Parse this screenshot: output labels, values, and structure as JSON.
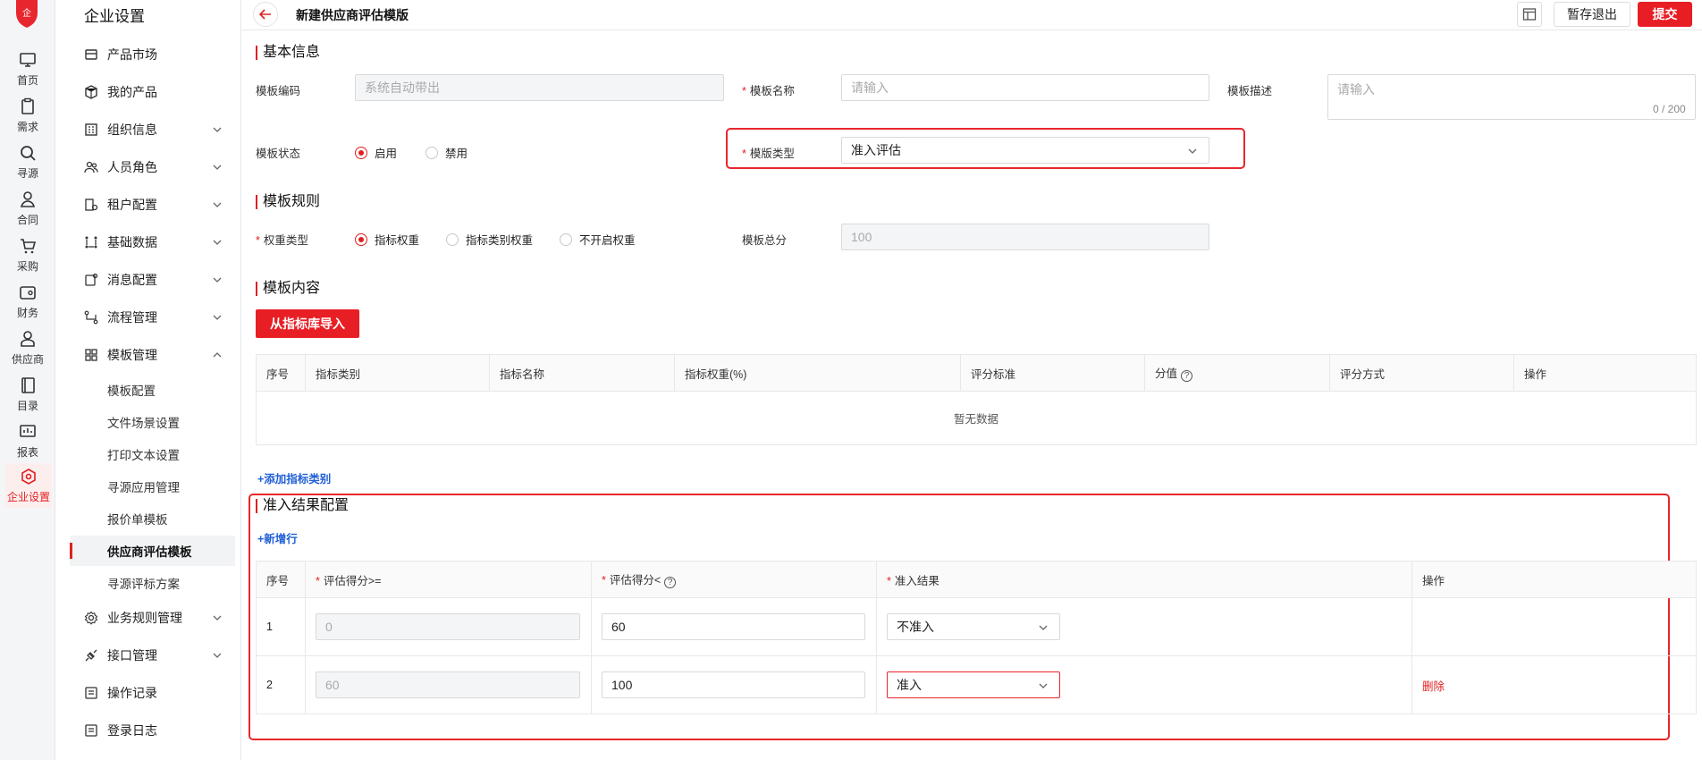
{
  "rail": {
    "logo_text": "企",
    "items": [
      {
        "label": "首页",
        "icon": "monitor-icon"
      },
      {
        "label": "需求",
        "icon": "clipboard-icon"
      },
      {
        "label": "寻源",
        "icon": "search-icon"
      },
      {
        "label": "合同",
        "icon": "person-icon"
      },
      {
        "label": "采购",
        "icon": "cart-icon"
      },
      {
        "label": "财务",
        "icon": "wallet-icon"
      },
      {
        "label": "供应商",
        "icon": "supplier-icon"
      },
      {
        "label": "目录",
        "icon": "book-icon"
      },
      {
        "label": "报表",
        "icon": "report-icon"
      },
      {
        "label": "企业设置",
        "icon": "gear-hex-icon"
      }
    ]
  },
  "menu": {
    "title": "企业设置",
    "items": [
      {
        "label": "产品市场"
      },
      {
        "label": "我的产品"
      },
      {
        "label": "组织信息"
      },
      {
        "label": "人员角色"
      },
      {
        "label": "租户配置"
      },
      {
        "label": "基础数据"
      },
      {
        "label": "消息配置"
      },
      {
        "label": "流程管理"
      },
      {
        "label": "模板管理"
      }
    ],
    "sub_items": [
      {
        "label": "模板配置"
      },
      {
        "label": "文件场景设置"
      },
      {
        "label": "打印文本设置"
      },
      {
        "label": "寻源应用管理"
      },
      {
        "label": "报价单模板"
      },
      {
        "label": "供应商评估模板"
      },
      {
        "label": "寻源评标方案"
      }
    ],
    "bottom_items": [
      {
        "label": "业务规则管理"
      },
      {
        "label": "接口管理"
      },
      {
        "label": "操作记录"
      },
      {
        "label": "登录日志"
      }
    ]
  },
  "header": {
    "title": "新建供应商评估模版",
    "save_exit": "暂存退出",
    "submit": "提交"
  },
  "basic": {
    "title": "基本信息",
    "code_label": "模板编码",
    "code_placeholder": "系统自动带出",
    "name_label": "模板名称",
    "name_placeholder": "请输入",
    "desc_label": "模板描述",
    "desc_placeholder": "请输入",
    "desc_counter": "0 / 200",
    "status_label": "模板状态",
    "status_enabled": "启用",
    "status_disabled": "禁用",
    "type_label": "模版类型",
    "type_value": "准入评估"
  },
  "rules": {
    "title": "模板规则",
    "weight_label": "权重类型",
    "weight_opt1": "指标权重",
    "weight_opt2": "指标类别权重",
    "weight_opt3": "不开启权重",
    "total_label": "模板总分",
    "total_value": "100"
  },
  "content": {
    "title": "模板内容",
    "import_btn": "从指标库导入",
    "columns": [
      "序号",
      "指标类别",
      "指标名称",
      "指标权重(%)",
      "评分标准",
      "分值",
      "评分方式",
      "操作"
    ],
    "empty_text": "暂无数据",
    "add_link": "+添加指标类别"
  },
  "result": {
    "title": "准入结果配置",
    "add_row": "+新增行",
    "columns": [
      "序号",
      "评估得分>=",
      "评估得分<",
      "准入结果",
      "操作"
    ],
    "rows": [
      {
        "index": "1",
        "from": "0",
        "to": "60",
        "result": "不准入",
        "action": ""
      },
      {
        "index": "2",
        "from": "60",
        "to": "100",
        "result": "准入",
        "action": "删除"
      }
    ]
  },
  "colors": {
    "accent": "#e81e25",
    "link": "#1f5fd6"
  }
}
